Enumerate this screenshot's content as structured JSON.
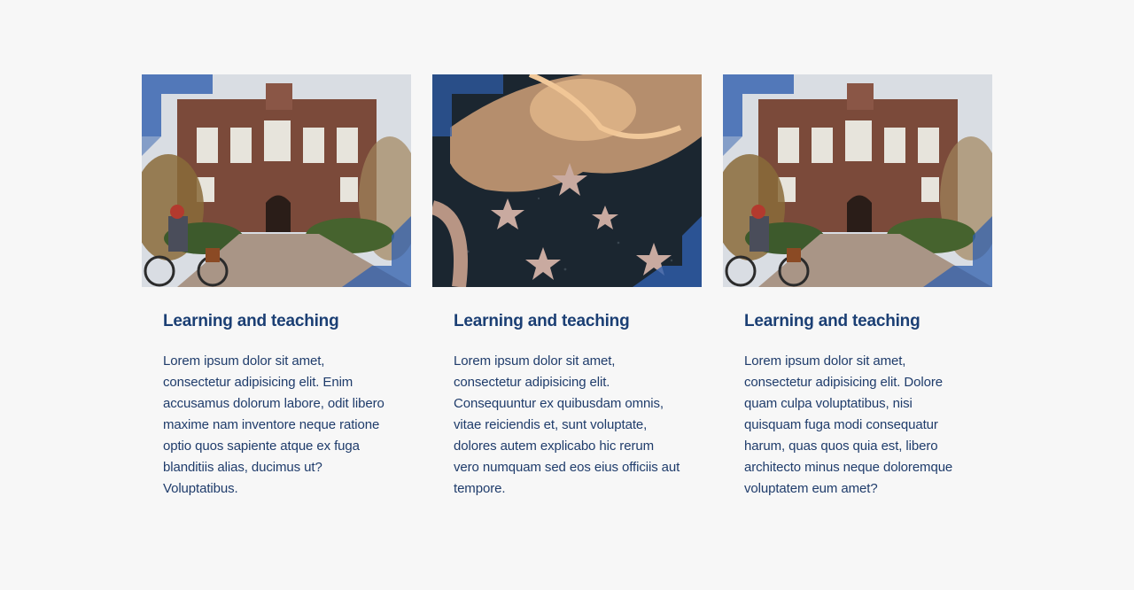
{
  "cards": [
    {
      "image_icon": "campus-building-photo",
      "title": "Learning and teaching",
      "text": "Lorem ipsum dolor sit amet, consectetur adipisicing elit. Enim accusamus dolorum labore, odit libero maxime nam inventore neque ratione optio quos sapiente atque ex fuga blanditiis alias, ducimus ut? Voluptatibus."
    },
    {
      "image_icon": "eagle-stars-emblem-photo",
      "title": "Learning and teaching",
      "text": "Lorem ipsum dolor sit amet, consectetur adipisicing elit. Consequuntur ex quibusdam omnis, vitae reiciendis et, sunt voluptate, dolores autem explicabo hic rerum vero numquam sed eos eius officiis aut tempore."
    },
    {
      "image_icon": "campus-building-photo",
      "title": "Learning and teaching",
      "text": "Lorem ipsum dolor sit amet, consectetur adipisicing elit. Dolore quam culpa voluptatibus, nisi quisquam fuga modi consequatur harum, quas quos quia est, libero architecto minus neque doloremque voluptatem eum amet?"
    }
  ],
  "colors": {
    "title": "#1b3f74",
    "text": "#1f3c6b",
    "accent": "#2f5fae",
    "background": "#f7f7f7"
  }
}
